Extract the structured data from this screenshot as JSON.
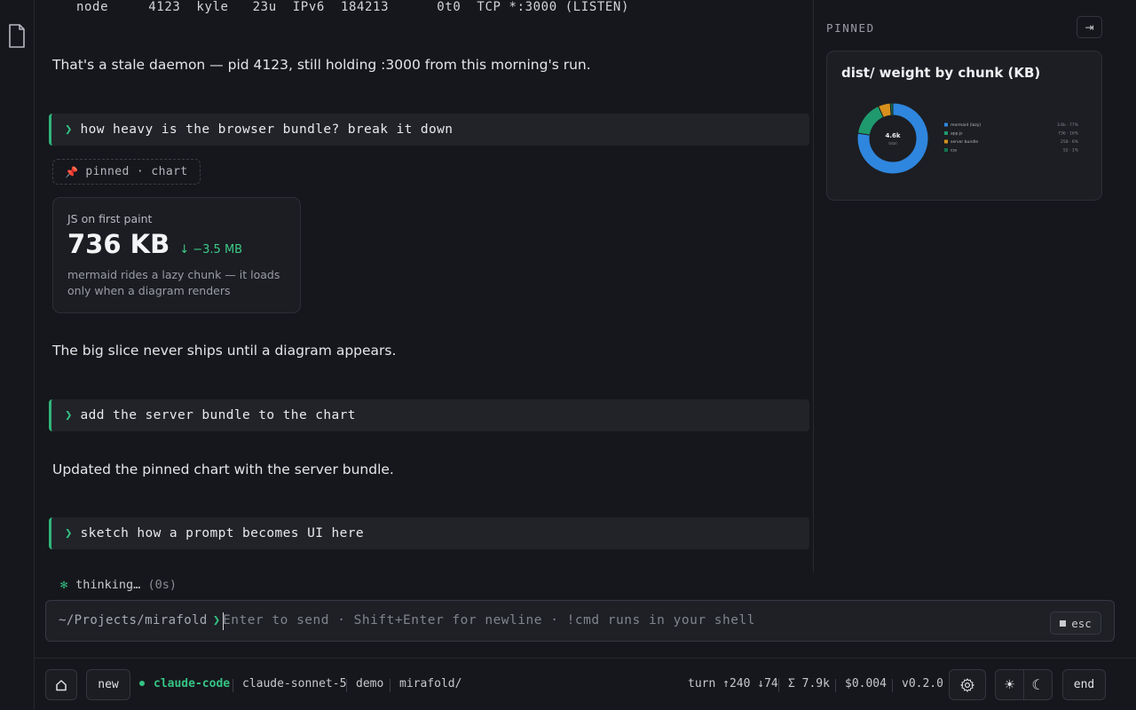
{
  "rail": {
    "file_icon": "file-icon"
  },
  "terminal": {
    "line": "node     4123  kyle   23u  IPv6  184213      0t0  TCP *:3000 (LISTEN)"
  },
  "messages": {
    "stale_daemon": "That's a stale daemon — pid 4123, still holding :3000 from this morning's run.",
    "prompt1": "how heavy is the browser bundle? break it down",
    "pinned_tag": "pinned · chart",
    "pin_icon": "📌",
    "stat": {
      "label": "JS on first paint",
      "value": "736 KB",
      "delta": "↓ −3.5 MB",
      "note": "mermaid rides a lazy chunk — it loads only when a diagram renders"
    },
    "big_slice": "The big slice never ships until a diagram appears.",
    "prompt2": "add the server bundle to the chart",
    "updated": "Updated the pinned chart with the server bundle.",
    "prompt3": "sketch how a prompt becomes UI here",
    "prompt_chevron": "❯"
  },
  "thinking": {
    "star": "✻",
    "label": "thinking…",
    "time": "(0s)"
  },
  "side_panel": {
    "heading": "PINNED",
    "collapse_icon": "⇥",
    "chart_title": "dist/ weight by chunk (KB)"
  },
  "chart_data": {
    "type": "pie",
    "title": "dist/ weight by chunk (KB)",
    "center_value": "4.6k",
    "center_label": "total",
    "categories": [
      "mermaid (lazy)",
      "app.js",
      "server bundle",
      "css"
    ],
    "values": [
      3580,
      736,
      258,
      52
    ],
    "value_labels": [
      "3.6k · 77%",
      "736 · 16%",
      "258 · 6%",
      "52 · 1%"
    ],
    "colors": [
      "#2f86de",
      "#1f9a6e",
      "#d8901c",
      "#13754f"
    ],
    "legend": "right"
  },
  "composer": {
    "cwd": "~/Projects/mirafold",
    "chevron": "❯",
    "placeholder": "Enter to send · Shift+Enter for newline · !cmd runs in your shell",
    "esc_label": "esc"
  },
  "statusbar": {
    "home_icon": "home-icon",
    "new_label": "new",
    "agent": "claude-code",
    "model": "claude-sonnet-5",
    "mode": "demo",
    "dir": "mirafold/",
    "turn": "turn ↑240 ↓74",
    "total": "Σ 7.9k",
    "cost": "$0.004",
    "version": "v0.2.0",
    "settings_icon": "gear-icon",
    "light_icon": "☀",
    "dark_icon": "☾",
    "end_label": "end"
  }
}
